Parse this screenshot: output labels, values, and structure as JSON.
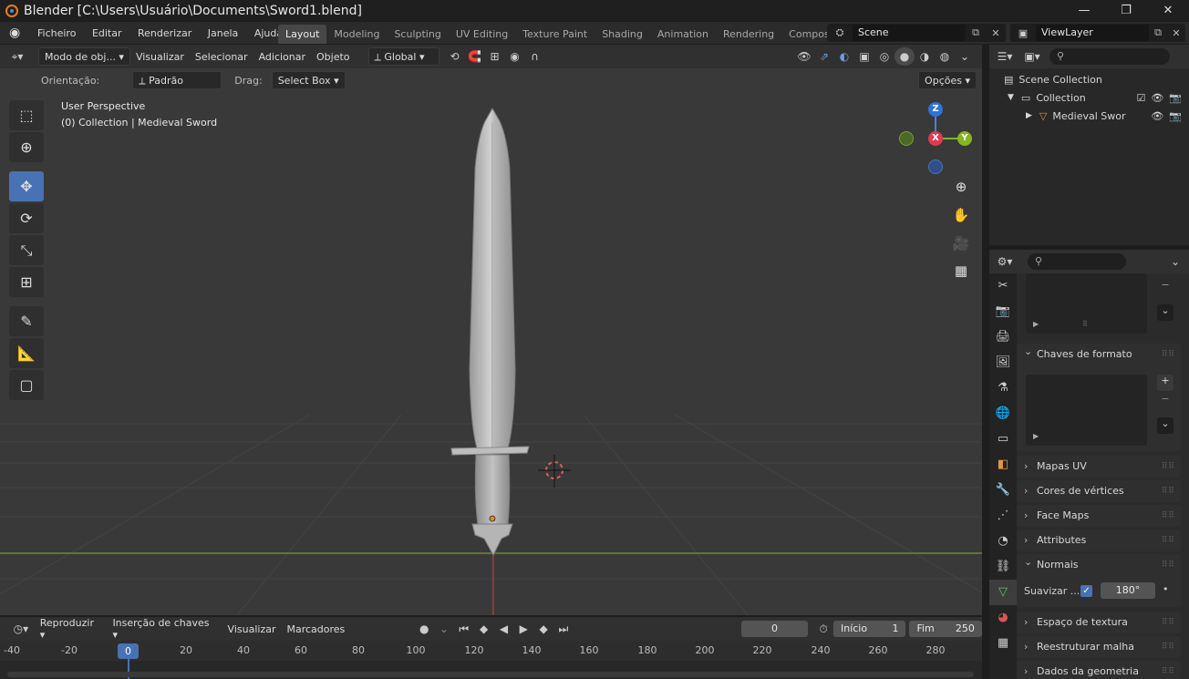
{
  "window": {
    "title": "Blender [C:\\Users\\Usuário\\Documents\\Sword1.blend]",
    "minimize": "—",
    "maximize": "❐",
    "close": "✕"
  },
  "menu": [
    "Ficheiro",
    "Editar",
    "Renderizar",
    "Janela",
    "Ajuda"
  ],
  "workspaces": [
    "Layout",
    "Modeling",
    "Sculpting",
    "UV Editing",
    "Texture Paint",
    "Shading",
    "Animation",
    "Rendering",
    "Composi"
  ],
  "active_workspace": "Layout",
  "scene": "Scene",
  "view_layer": "ViewLayer",
  "viewport_header": {
    "mode": "Modo de obj...",
    "menus": [
      "Visualizar",
      "Selecionar",
      "Adicionar",
      "Objeto"
    ],
    "transform": "Global"
  },
  "viewport_sub": {
    "orientation_label": "Orientação:",
    "orientation_value": "Padrão",
    "drag_label": "Drag:",
    "drag_value": "Select Box",
    "options": "Opções"
  },
  "viewport_info": {
    "line1": "User Perspective",
    "line2": "(0) Collection | Medieval Sword"
  },
  "gizmo": {
    "x": "X",
    "y": "Y",
    "z": "Z"
  },
  "outliner": {
    "scene_collection": "Scene Collection",
    "collection": "Collection",
    "object": "Medieval Swor"
  },
  "properties": {
    "shape_keys": "Chaves de formato",
    "uv_maps": "Mapas UV",
    "vertex_colors": "Cores de vértices",
    "face_maps": "Face Maps",
    "attributes": "Attributes",
    "normals": "Normais",
    "auto_smooth_label": "Suavizar ...",
    "auto_smooth_angle": "180°",
    "texture_space": "Espaço de textura",
    "remesh": "Reestruturar malha",
    "geometry_data": "Dados da geometria"
  },
  "timeline": {
    "menus": [
      "Reproduzir",
      "Inserção de chaves",
      "Visualizar",
      "Marcadores"
    ],
    "current_frame": "0",
    "start_label": "Início",
    "start_value": "1",
    "end_label": "Fim",
    "end_value": "250",
    "ruler": [
      "-40",
      "-20",
      "0",
      "20",
      "40",
      "60",
      "80",
      "100",
      "120",
      "140",
      "160",
      "180",
      "200",
      "220",
      "240",
      "260",
      "280"
    ],
    "playhead": "0"
  }
}
